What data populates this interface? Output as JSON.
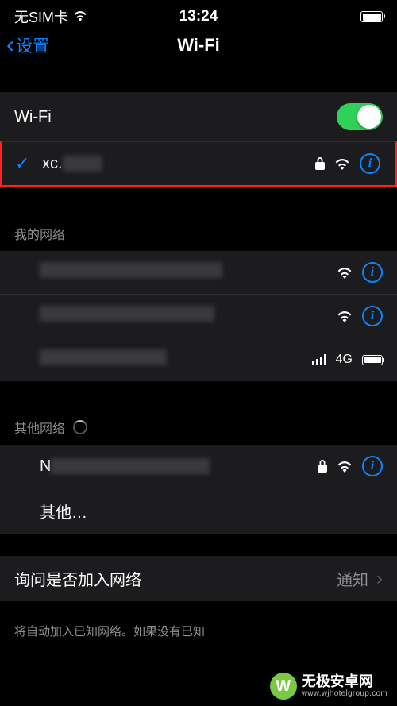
{
  "status": {
    "carrier": "无SIM卡",
    "time": "13:24"
  },
  "nav": {
    "back_label": "设置",
    "title": "Wi-Fi"
  },
  "sections": {
    "wifi_toggle": {
      "label": "Wi-Fi",
      "on": true
    },
    "connected": {
      "ssid_prefix": "xc.",
      "ssid_hidden": true,
      "secured": true
    },
    "my_networks_header": "我的网络",
    "my_networks": [
      {
        "ssid_hidden": true,
        "secured": false,
        "signal": "wifi"
      },
      {
        "ssid_hidden": true,
        "secured": false,
        "signal": "wifi"
      },
      {
        "ssid_hidden": true,
        "secured": false,
        "signal": "cellular",
        "cellular_label": "4G"
      }
    ],
    "other_networks_header": "其他网络",
    "others": [
      {
        "ssid_prefix": "N",
        "ssid_hidden": true,
        "secured": true
      }
    ],
    "other_label": "其他…",
    "ask_join": {
      "label": "询问是否加入网络",
      "value": "通知"
    },
    "ask_join_footer": "将自动加入已知网络。如果没有已知"
  },
  "watermark": {
    "logo_char": "W",
    "name": "无极安卓网",
    "url": "www.wjhotelgroup.com"
  }
}
